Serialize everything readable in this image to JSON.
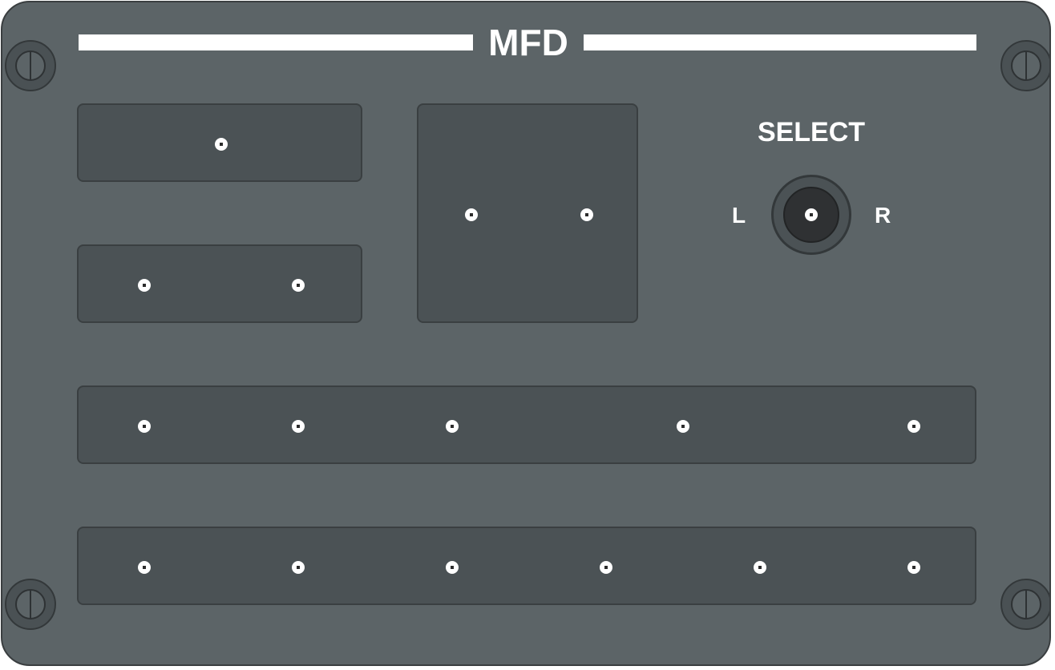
{
  "panel": {
    "title": "MFD",
    "select": {
      "label": "SELECT",
      "left_label": "L",
      "right_label": "R"
    }
  }
}
